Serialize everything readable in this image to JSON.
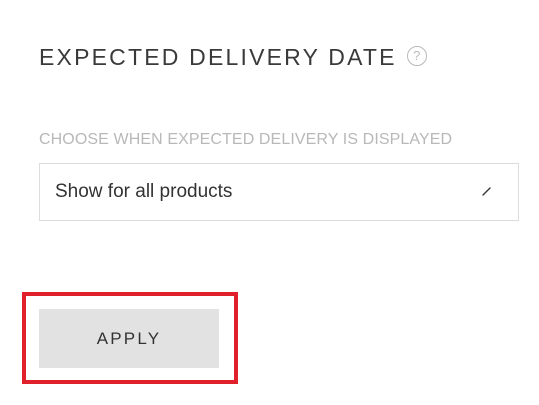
{
  "section": {
    "title": "EXPECTED DELIVERY DATE",
    "help_icon": "question-mark-circle-icon",
    "help_glyph": "?"
  },
  "field": {
    "label": "CHOOSE WHEN EXPECTED DELIVERY IS DISPLAYED",
    "selected_value": "Show for all products",
    "arrow_icon": "chevron-down-icon"
  },
  "actions": {
    "apply_label": "APPLY"
  },
  "colors": {
    "highlight": "#e0202a",
    "button_bg": "#e2e2e2",
    "label": "#b8b8b8"
  }
}
